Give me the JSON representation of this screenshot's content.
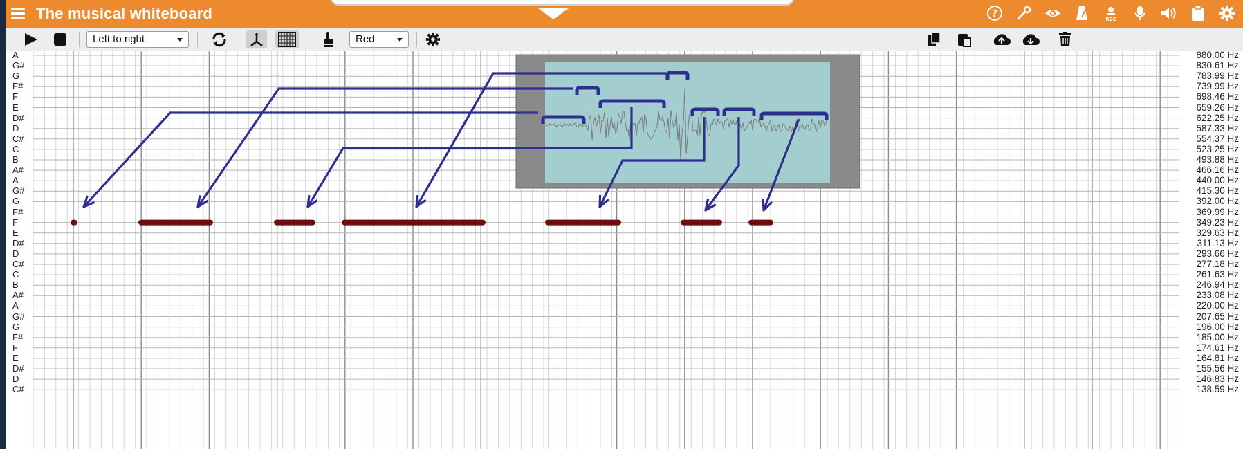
{
  "title": "The musical whiteboard",
  "toolbar": {
    "direction": "Left to right",
    "color": "Red"
  },
  "note_labels": [
    "A",
    "G#",
    "G",
    "F#",
    "F",
    "E",
    "D#",
    "D",
    "C#",
    "C",
    "B",
    "A#",
    "A",
    "G#",
    "G",
    "F#",
    "F",
    "E",
    "D#",
    "D",
    "C#",
    "C",
    "B",
    "A#",
    "A",
    "G#",
    "G",
    "F#",
    "F",
    "E",
    "D#",
    "D",
    "C#"
  ],
  "frequencies": [
    "880.00 Hz",
    "830.61 Hz",
    "783.99 Hz",
    "739.99 Hz",
    "698.46 Hz",
    "659.26 Hz",
    "622.25 Hz",
    "587.33 Hz",
    "554.37 Hz",
    "523.25 Hz",
    "493.88 Hz",
    "466.16 Hz",
    "440.00 Hz",
    "415.30 Hz",
    "392.00 Hz",
    "369.99 Hz",
    "349.23 Hz",
    "329.63 Hz",
    "311.13 Hz",
    "293.66 Hz",
    "277.18 Hz",
    "261.63 Hz",
    "246.94 Hz",
    "233.08 Hz",
    "220.00 Hz",
    "207.65 Hz",
    "196.00 Hz",
    "185.00 Hz",
    "174.61 Hz",
    "164.81 Hz",
    "155.56 Hz",
    "146.83 Hz",
    "138.59 Hz"
  ],
  "colors": {
    "titlebar": "#ee8a2e",
    "note_stroke": "#6b0f0f",
    "annotation": "#2e2e8f",
    "waveform_panel": "#8a8a8a",
    "waveform_bg": "#a8d8dc"
  },
  "icons": {
    "title": [
      "help-icon",
      "wrench-icon",
      "eye-icon",
      "metronome-icon",
      "record-icon",
      "microphone-icon",
      "speaker-icon",
      "clipboard-icon",
      "settings-icon"
    ],
    "toolbar_left": [
      "play-icon",
      "stop-icon",
      "loop-icon",
      "axes-icon",
      "grid-icon",
      "pointer-hand-icon",
      "settings-icon"
    ],
    "toolbar_right": [
      "copy-icon",
      "paste-icon",
      "cloud-upload-icon",
      "cloud-download-icon",
      "trash-icon"
    ]
  }
}
